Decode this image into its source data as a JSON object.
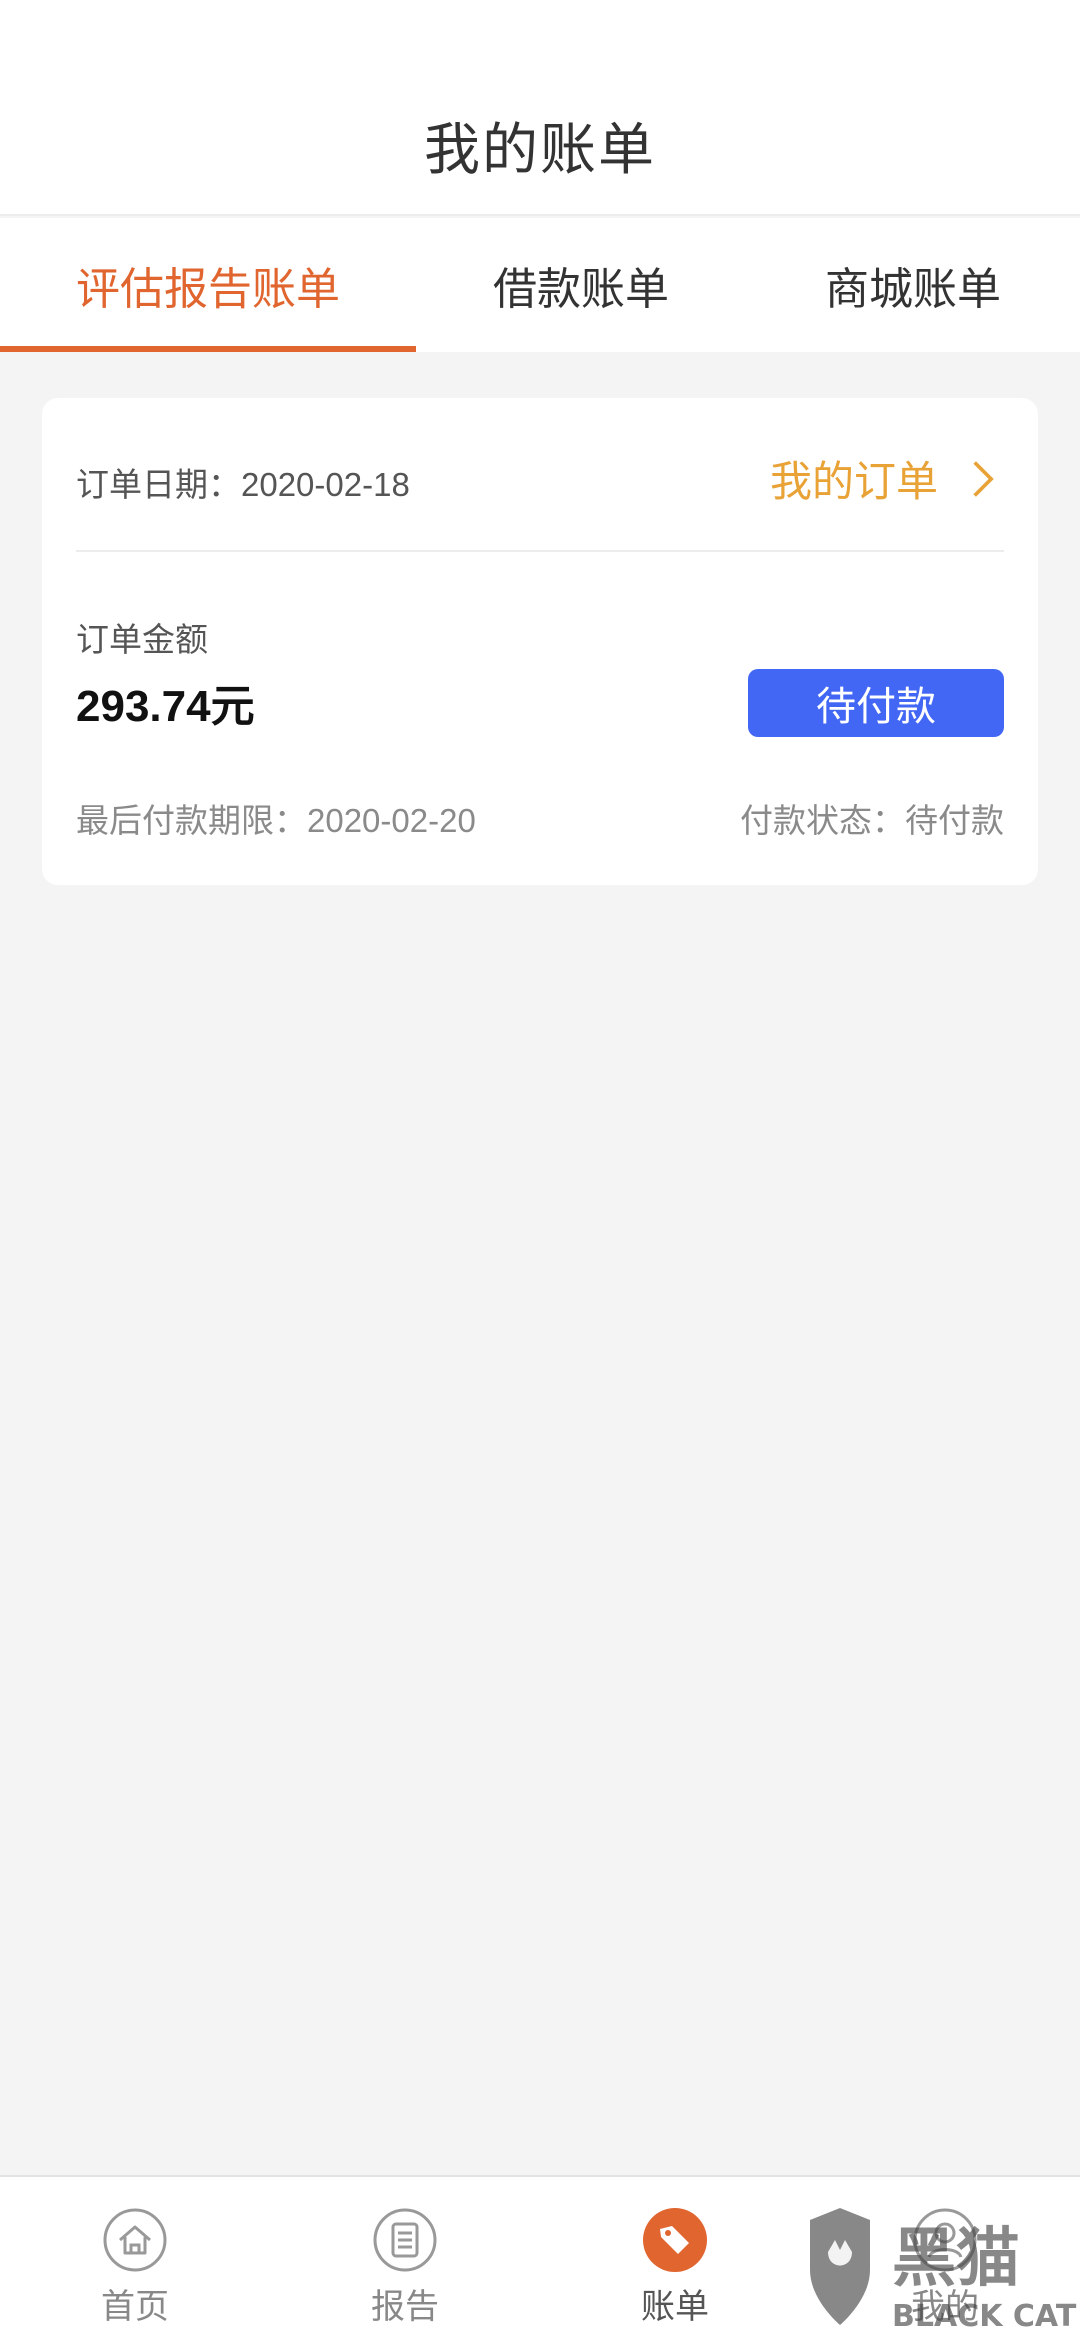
{
  "header": {
    "title": "我的账单"
  },
  "tabs": [
    {
      "label": "评估报告账单",
      "active": true
    },
    {
      "label": "借款账单",
      "active": false
    },
    {
      "label": "商城账单",
      "active": false
    }
  ],
  "colors": {
    "accent": "#e0652f",
    "link": "#e8a236",
    "button": "#4267f5"
  },
  "card": {
    "order_date": "订单日期：2020-02-18",
    "my_order_link": "我的订单",
    "amount_label": "订单金额",
    "amount_value": "293.74元",
    "pay_button": "待付款",
    "deadline": "最后付款期限：2020-02-20",
    "pay_status": "付款状态：待付款"
  },
  "bottom_nav": [
    {
      "label": "首页",
      "icon": "home-icon",
      "active": false
    },
    {
      "label": "报告",
      "icon": "report-icon",
      "active": false
    },
    {
      "label": "账单",
      "icon": "bill-tag-icon",
      "active": true
    },
    {
      "label": "我的",
      "icon": "user-icon",
      "active": false
    }
  ],
  "watermark": {
    "title": "黑猫",
    "subtitle": "BLACK CAT"
  }
}
